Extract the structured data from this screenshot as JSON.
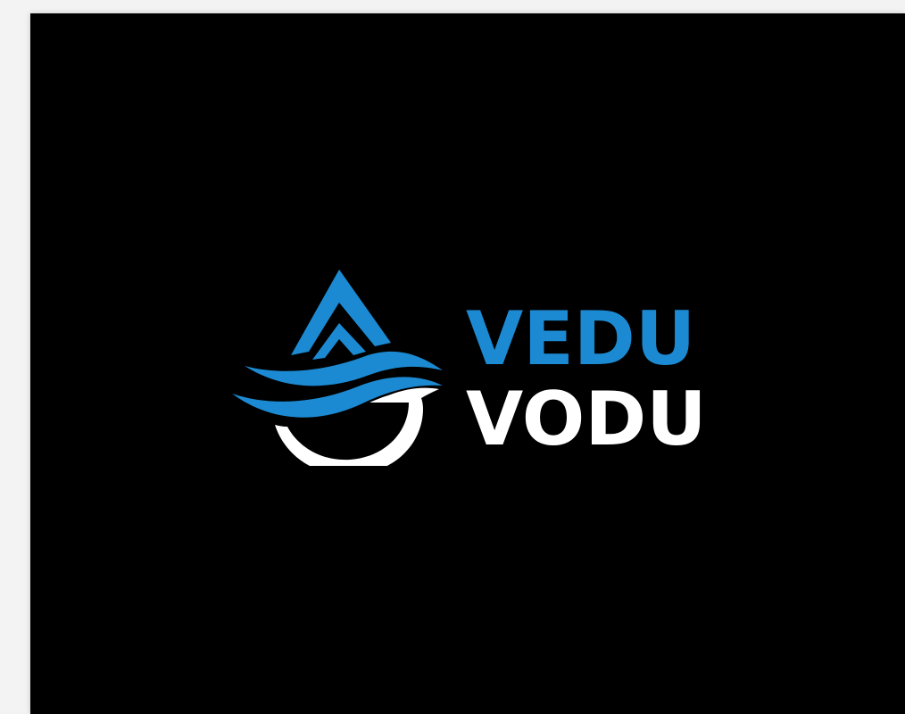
{
  "brand": {
    "name_top": "VEDU",
    "name_bottom": "VODU",
    "colors": {
      "background": "#000000",
      "page": "#f3f3f3",
      "accent_blue": "#1c8ad2",
      "white": "#ffffff"
    },
    "icon_name": "water-drop-wave-icon"
  }
}
